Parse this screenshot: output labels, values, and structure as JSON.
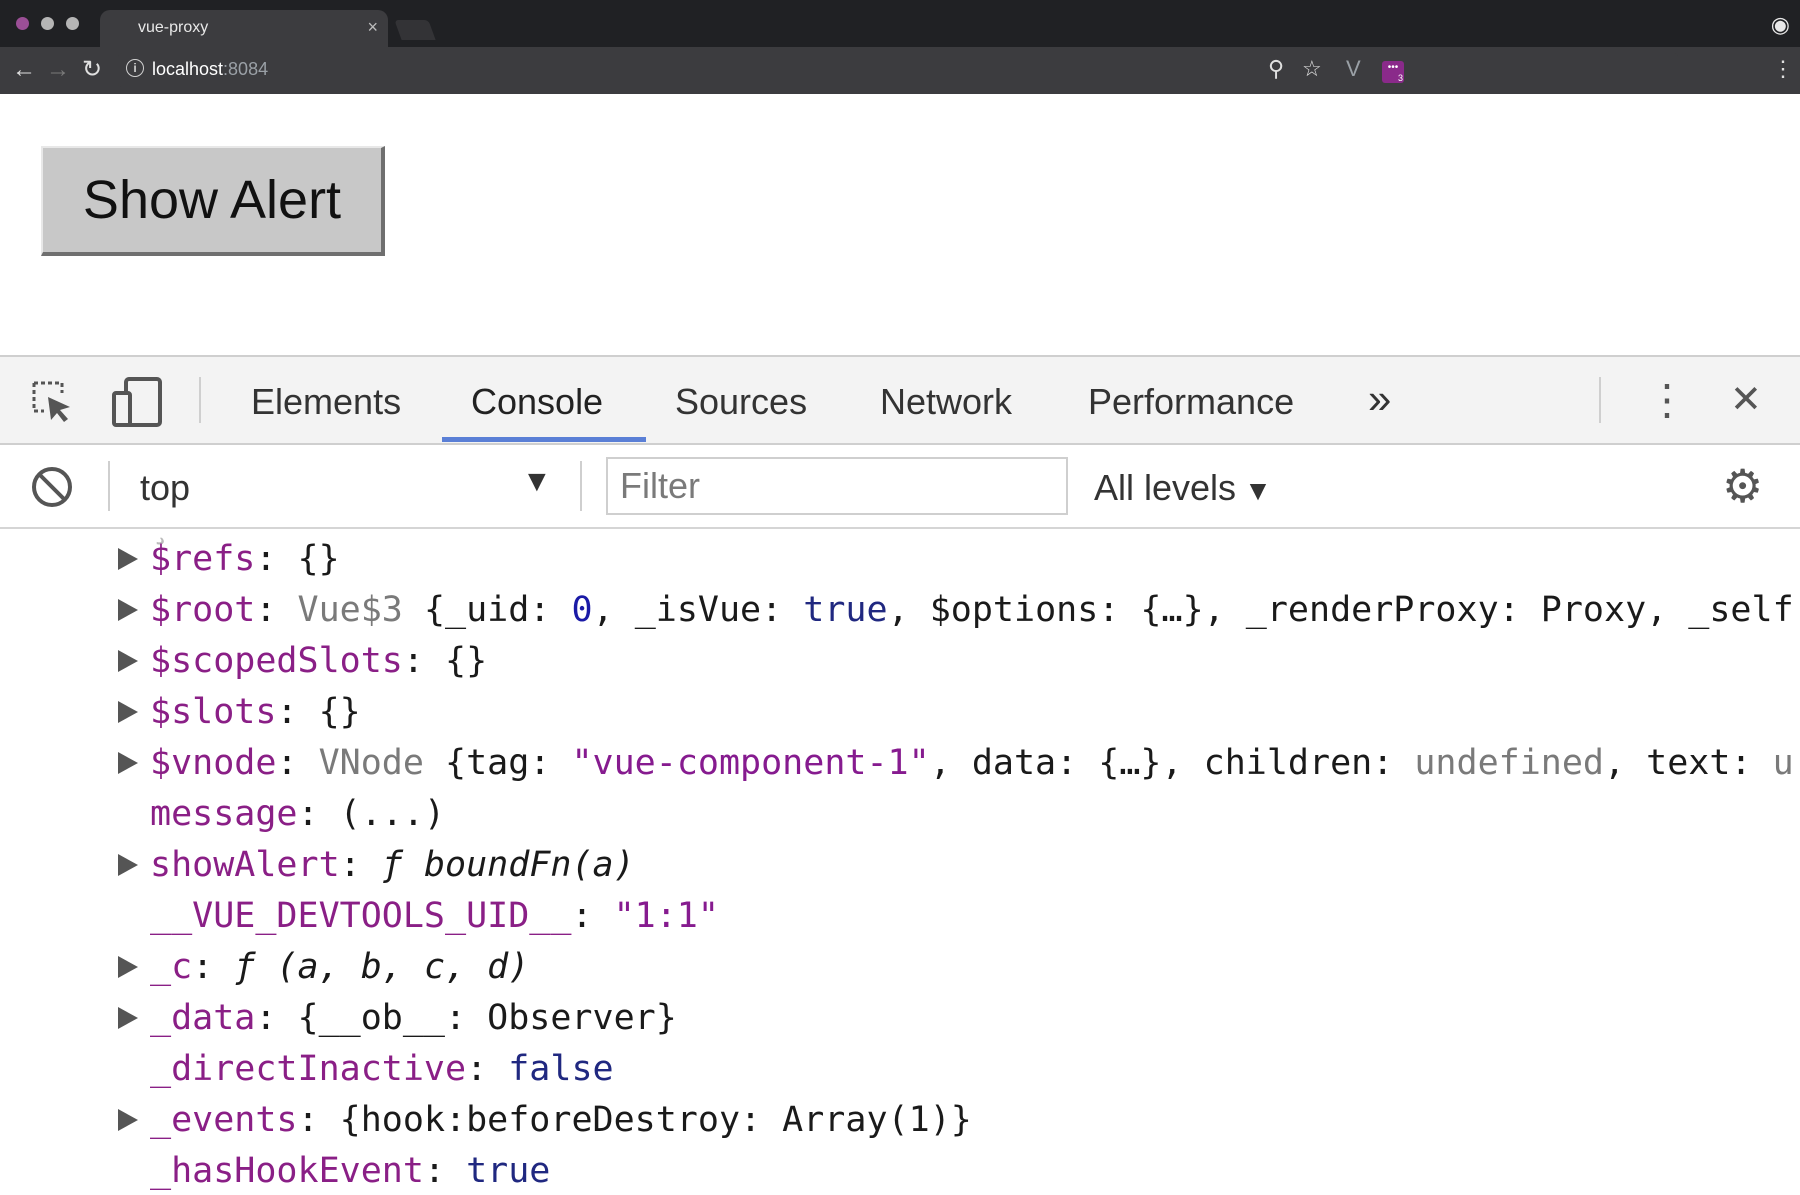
{
  "browser": {
    "tab_title": "vue-proxy",
    "tab_close": "×",
    "url_host": "localhost",
    "url_port": ":8084",
    "icons": [
      "back-arrow-icon",
      "forward-arrow-icon",
      "reload-icon",
      "info-icon",
      "zoom-icon",
      "star-icon",
      "vue-extension-icon",
      "extension-badge-icon",
      "menu-dots-icon",
      "incognito-icon"
    ],
    "badge_count": "3"
  },
  "page": {
    "button_label": "Show Alert"
  },
  "devtools": {
    "tabs": [
      "Elements",
      "Console",
      "Sources",
      "Network",
      "Performance"
    ],
    "more": "»",
    "close": "✕",
    "menu": "⋮",
    "context": "top",
    "filter_placeholder": "Filter",
    "levels": "All levels"
  },
  "console_lines": [
    {
      "expandable": true,
      "parts": [
        [
          "k",
          "$refs"
        ],
        [
          "p",
          ": {}"
        ]
      ]
    },
    {
      "expandable": true,
      "parts": [
        [
          "k",
          "$root"
        ],
        [
          "p",
          ": "
        ],
        [
          "g",
          "Vue$3 "
        ],
        [
          "p",
          "{_uid: "
        ],
        [
          "n",
          "0"
        ],
        [
          "p",
          ", _isVue: "
        ],
        [
          "b",
          "true"
        ],
        [
          "p",
          ", $options: {…}, _renderProxy: Proxy, _self"
        ]
      ]
    },
    {
      "expandable": true,
      "parts": [
        [
          "k",
          "$scopedSlots"
        ],
        [
          "p",
          ": {}"
        ]
      ]
    },
    {
      "expandable": true,
      "parts": [
        [
          "k",
          "$slots"
        ],
        [
          "p",
          ": {}"
        ]
      ]
    },
    {
      "expandable": true,
      "parts": [
        [
          "k",
          "$vnode"
        ],
        [
          "p",
          ": "
        ],
        [
          "g",
          "VNode "
        ],
        [
          "p",
          "{tag: "
        ],
        [
          "s",
          "\"vue-component-1\""
        ],
        [
          "p",
          ", data: {…}, children: "
        ],
        [
          "g",
          "undefined"
        ],
        [
          "p",
          ", text: "
        ],
        [
          "g",
          "u"
        ]
      ]
    },
    {
      "expandable": false,
      "parts": [
        [
          "k",
          "message"
        ],
        [
          "p",
          ": (...)"
        ]
      ]
    },
    {
      "expandable": true,
      "parts": [
        [
          "k",
          "showAlert"
        ],
        [
          "p",
          ": "
        ],
        [
          "i",
          "ƒ boundFn(a)"
        ]
      ]
    },
    {
      "expandable": false,
      "parts": [
        [
          "k",
          "__VUE_DEVTOOLS_UID__"
        ],
        [
          "p",
          ": "
        ],
        [
          "s",
          "\"1:1\""
        ]
      ]
    },
    {
      "expandable": true,
      "parts": [
        [
          "k",
          "_c"
        ],
        [
          "p",
          ": "
        ],
        [
          "i",
          "ƒ (a, b, c, d)"
        ]
      ]
    },
    {
      "expandable": true,
      "parts": [
        [
          "k",
          "_data"
        ],
        [
          "p",
          ": {__ob__: Observer}"
        ]
      ]
    },
    {
      "expandable": false,
      "parts": [
        [
          "k",
          "_directInactive"
        ],
        [
          "p",
          ": "
        ],
        [
          "b",
          "false"
        ]
      ]
    },
    {
      "expandable": true,
      "parts": [
        [
          "k",
          "_events"
        ],
        [
          "p",
          ": {hook:beforeDestroy: Array(1)}"
        ]
      ]
    },
    {
      "expandable": false,
      "parts": [
        [
          "k",
          "_hasHookEvent"
        ],
        [
          "p",
          ": "
        ],
        [
          "b",
          "true"
        ]
      ]
    }
  ]
}
